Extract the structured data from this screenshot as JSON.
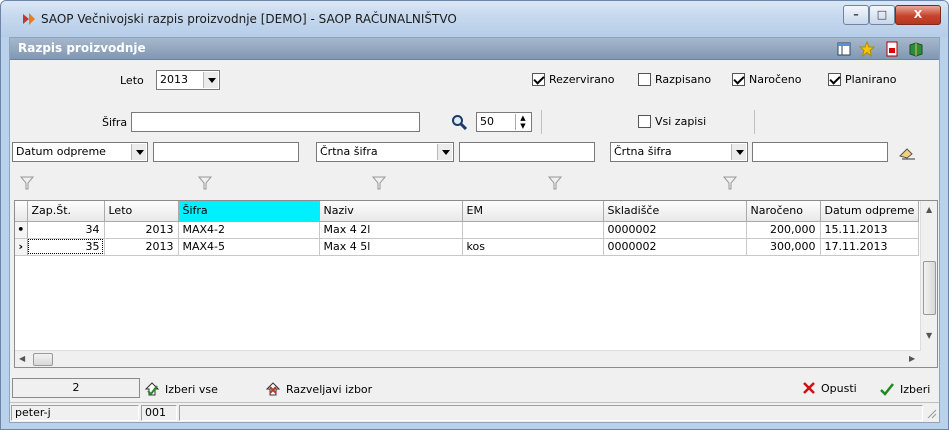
{
  "window": {
    "title": "SAOP Večnivojski razpis proizvodnje [DEMO] - SAOP RAČUNALNIŠTVO"
  },
  "header": {
    "title": "Razpis proizvodnje"
  },
  "filters": {
    "leto_label": "Leto",
    "leto_value": "2013",
    "checks": [
      {
        "label": "Rezervirano",
        "checked": true
      },
      {
        "label": "Razpisano",
        "checked": false
      },
      {
        "label": "Naročeno",
        "checked": true
      },
      {
        "label": "Planirano",
        "checked": true
      }
    ],
    "sifra_label": "Šifra",
    "sifra_value": "",
    "limit_value": "50",
    "vsi_zapisi_label": "Vsi zapisi",
    "vsi_zapisi_checked": false,
    "combo1": "Datum odpreme",
    "combo2": "Črtna šifra",
    "combo3": "Črtna šifra"
  },
  "grid": {
    "columns": [
      "Zap.Št.",
      "Leto",
      "Šifra",
      "Naziv",
      "EM",
      "Skladišče",
      "Naročeno",
      "Datum odpreme"
    ],
    "rows": [
      {
        "indicator": "•",
        "zap": "34",
        "leto": "2013",
        "sifra": "MAX4-2",
        "naziv": "Max 4 2l",
        "em": "",
        "skladisce": "0000002",
        "naroceno": "200,000",
        "datum": "15.11.2013"
      },
      {
        "indicator": "›",
        "zap": "35",
        "leto": "2013",
        "sifra": "MAX4-5",
        "naziv": "Max 4 5l",
        "em": "kos",
        "skladisce": "0000002",
        "naroceno": "300,000",
        "datum": "17.11.2013"
      }
    ]
  },
  "bottom": {
    "count": "2",
    "izberi_vse": "Izberi vse",
    "razveljavi_izbor": "Razveljavi izbor",
    "opusti": "Opusti",
    "izberi": "Izberi"
  },
  "status": {
    "user": "peter-j",
    "code": "001"
  },
  "colors": {
    "sorted_header": "#00f0ff",
    "header_band": "#8097b3"
  }
}
